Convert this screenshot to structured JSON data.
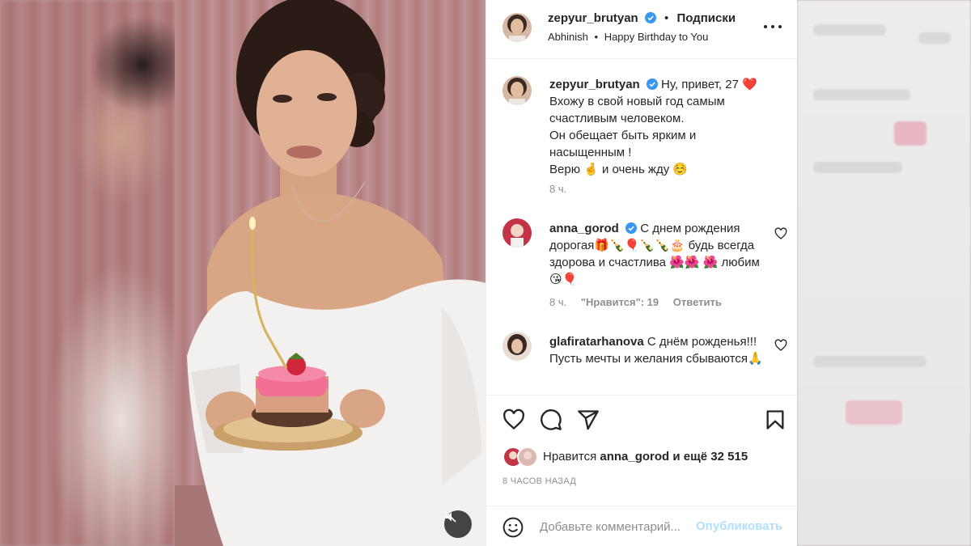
{
  "post": {
    "username": "zepyur_brutyan",
    "follow_label": "Подписки",
    "audio_artist": "Abhinish",
    "audio_track": "Happy Birthday to You"
  },
  "caption": {
    "username": "zepyur_brutyan",
    "line1": "Ну, привет, 27 ❤️",
    "line2": "Вхожу в свой новый год самым счастливым человеком.",
    "line3": "Он обещает быть ярким и насыщенным !",
    "line4": "Верю 🤞 и очень жду ☺️",
    "time": "8 ч."
  },
  "comments": [
    {
      "username": "anna_gorod",
      "text": "С днем рождения дорогая🎁🍾🎈🍾🍾🎂 будь всегда здорова и счастлива 🌺🌺 🌺 любим 😘🎈",
      "time": "8 ч.",
      "likes": "\"Нравится\": 19",
      "reply": "Ответить"
    },
    {
      "username": "glafiratarhanova",
      "text": "С днём рожденья!!! Пусть мечты и желания сбываются🙏"
    }
  ],
  "likes": {
    "prefix": "Нравится",
    "user": "anna_gorod",
    "suffix": "и ещё 32 515"
  },
  "time_ago": "8 ЧАСОВ НАЗАД",
  "comment_input": {
    "placeholder": "Добавьте комментарий...",
    "post_label": "Опубликовать"
  },
  "colors": {
    "verified": "#3897f0",
    "heart_red": "#ed4956",
    "link_disabled": "#b2dffc"
  },
  "icons": [
    "heart-icon",
    "comment-icon",
    "share-icon",
    "bookmark-icon",
    "more-icon",
    "mute-icon",
    "emoji-icon",
    "verified-icon"
  ]
}
